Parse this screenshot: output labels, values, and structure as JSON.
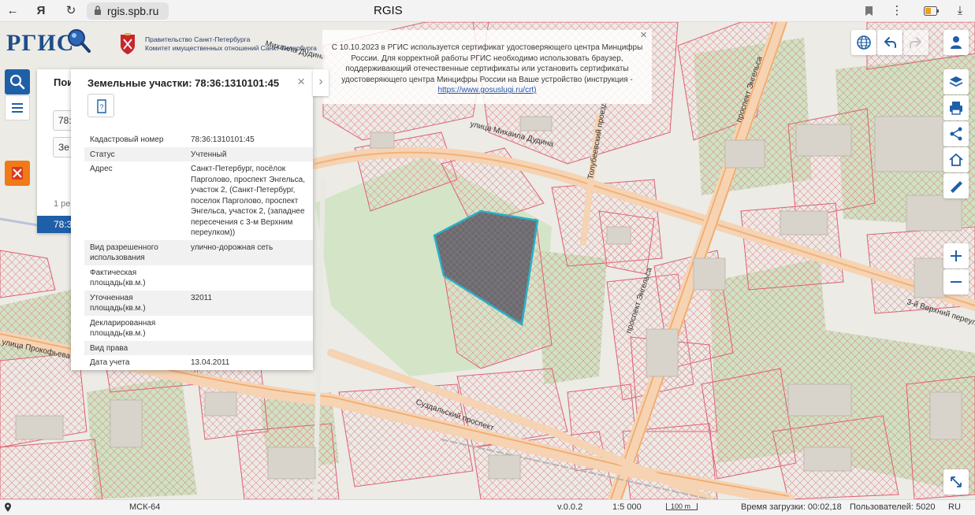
{
  "browser": {
    "url": "rgis.spb.ru",
    "tab_title": "RGIS",
    "back_icon": "arrow-left-icon",
    "yandex_icon": "yandex-icon",
    "reload_icon": "reload-icon",
    "bookmark_icon": "bookmark-icon",
    "menu_icon": "more-icon",
    "battery_icon": "battery-icon",
    "download_icon": "download-icon"
  },
  "header": {
    "logo_text": "РГИС",
    "gov_line1": "Правительство Санкт-Петербурга",
    "gov_line2": "Комитет имущественных отношений Санкт-Петербурга"
  },
  "notice": {
    "text": "С 10.10.2023 в РГИС используется сертификат удостоверяющего центра Минцифры России. Для корректной работы РГИС необходимо использовать браузер, поддерживающий отечественные сертификаты или установить сертификаты удостоверяющего центра Минцифры России на Ваше устройство (инструкция -",
    "link": "https://www.gosuslugi.ru/crt)",
    "close": "×"
  },
  "search_panel": {
    "title": "Пои",
    "field1": "78:3",
    "field2": "Зе",
    "count": "1 ре",
    "result": "78:3"
  },
  "info": {
    "title": "Земельные участки: 78:36:1310101:45",
    "close": "×",
    "rows": [
      {
        "key": "Кадастровый номер",
        "value": "78:36:1310101:45"
      },
      {
        "key": "Статус",
        "value": "Учтенный"
      },
      {
        "key": "Адрес",
        "value": "Санкт-Петербург, посёлок Парголово, проспект Энгельса, участок 2, (Санкт-Петербург, поселок Парголово, проспект Энгельса, участок 2, (западнее пересечения с 3-м Верхним переулком))"
      },
      {
        "key": "Вид разрешенного использования",
        "value": "улично-дорожная сеть"
      },
      {
        "key": "Фактическая площадь(кв.м.)",
        "value": ""
      },
      {
        "key": "Уточненная площадь(кв.м.)",
        "value": "32011"
      },
      {
        "key": "Декларированная площадь(кв.м.)",
        "value": ""
      },
      {
        "key": "Вид права",
        "value": ""
      },
      {
        "key": "Дата учета",
        "value": "13.04.2011"
      }
    ]
  },
  "map_labels": {
    "street1": "улица Михаила Дудина",
    "street2": "Толубеевский проезд",
    "street3": "проспект Энгельса",
    "street4": "проспект Энгельса",
    "street5": "3-й Верхний переулок",
    "street6": "улица Прокофьева",
    "street7": "Суздальский проспект",
    "street8": "Михаила Дудина"
  },
  "status": {
    "crs": "МСК-64",
    "version": "v.0.0.2",
    "scale": "1:5 000",
    "scale_bar": "100 m",
    "load_time": "Время загрузки: 00:02,18",
    "users": "Пользователей: 5020",
    "lang": "RU"
  },
  "colors": {
    "accent": "#1f5fa8",
    "coat_btn": "#f07a18",
    "parcel_outline": "#e06070",
    "selected_fill": "#6b6a6f",
    "selected_outline": "#2ab0c8",
    "road": "#f2b27a",
    "green": "#cfe3c1"
  }
}
